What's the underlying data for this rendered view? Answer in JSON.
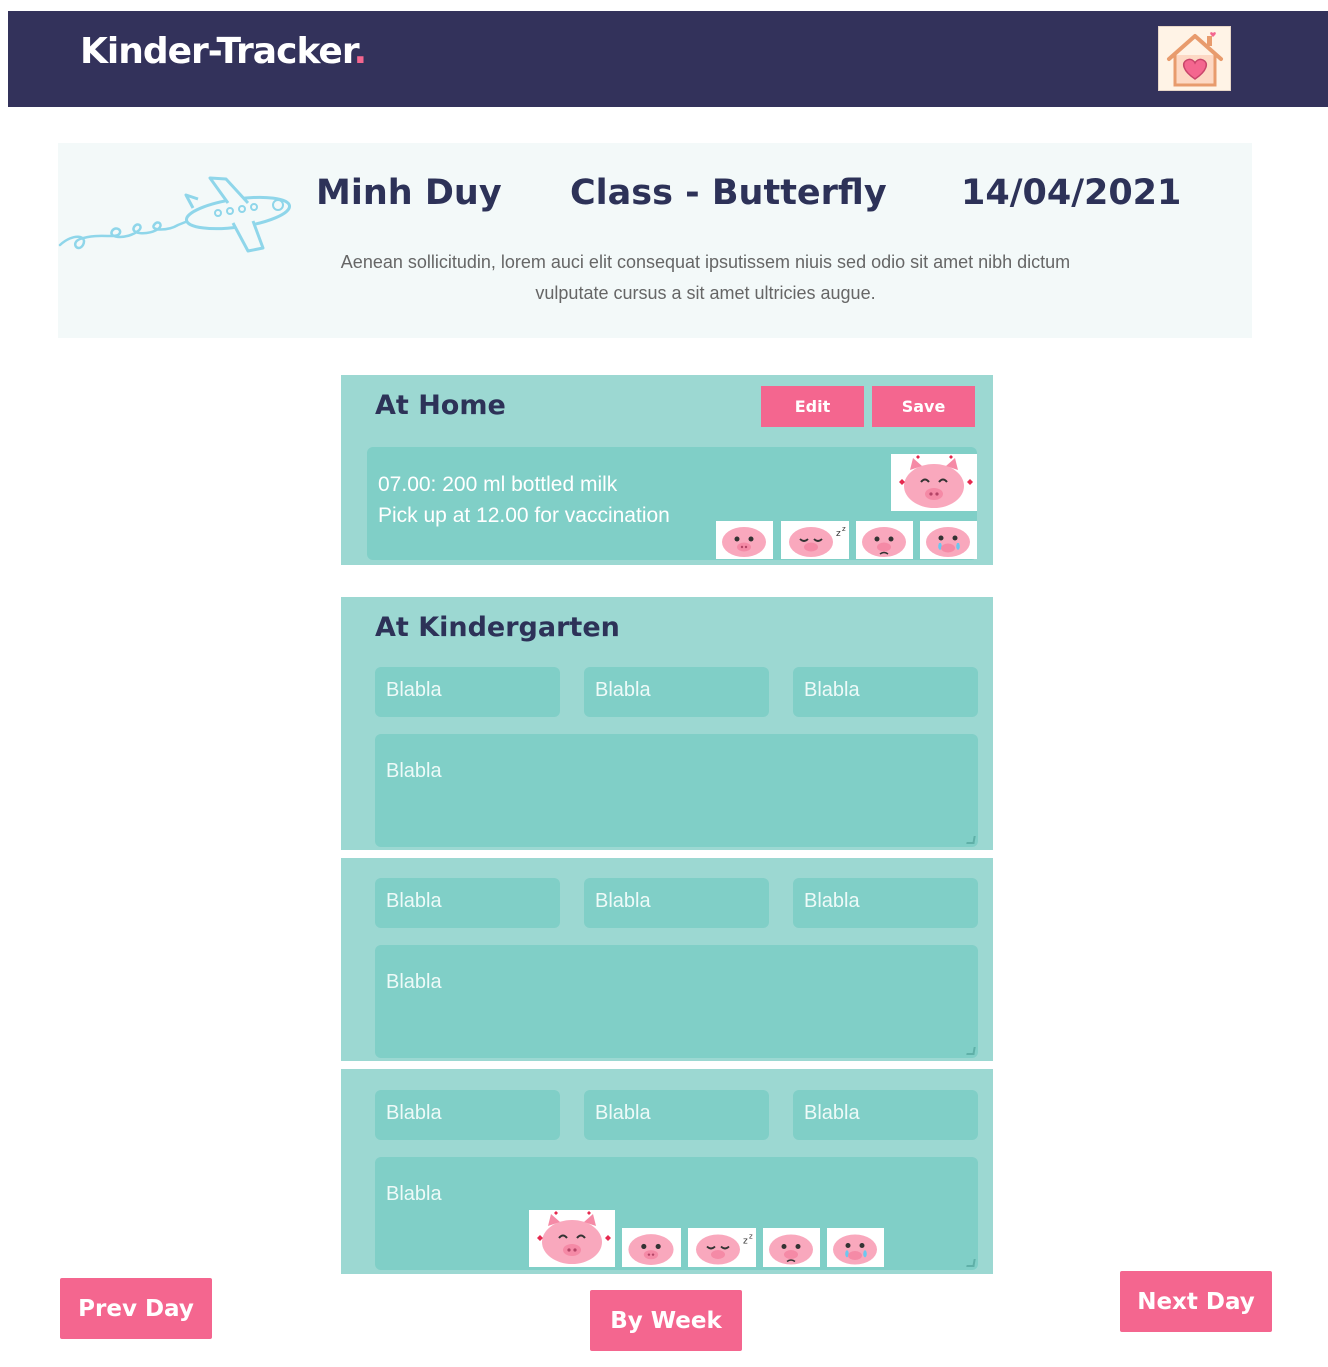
{
  "app": {
    "logo_text": "Kinder-Tracker",
    "logo_dot": ".",
    "home_icon": "house-heart-icon"
  },
  "profile": {
    "child_name": "Minh Duy",
    "class_label": "Class - Butterfly",
    "date": "14/04/2021",
    "description": "Aenean sollicitudin, lorem auci elit consequat ipsutissem niuis sed odio sit amet nibh dictum vulputate cursus a sit amet ultricies augue.",
    "decoration_icon": "airplane-icon"
  },
  "at_home": {
    "title": "At Home",
    "edit_label": "Edit",
    "save_label": "Save",
    "lines": [
      "07.00:  200 ml bottled milk",
      "Pick up at 12.00 for vaccination"
    ],
    "selected_mood": "pig-happy-love-icon",
    "mood_options": [
      "pig-happy-icon",
      "pig-sleepy-icon",
      "pig-sad-icon",
      "pig-crying-icon"
    ]
  },
  "at_kindergarten": {
    "title": "At Kindergarten",
    "blocks": [
      {
        "fields": [
          "Blabla",
          "Blabla",
          "Blabla"
        ],
        "notes": "Blabla"
      },
      {
        "fields": [
          "Blabla",
          "Blabla",
          "Blabla"
        ],
        "notes": "Blabla"
      },
      {
        "fields": [
          "Blabla",
          "Blabla",
          "Blabla"
        ],
        "notes": "Blabla"
      }
    ],
    "selected_mood": "pig-happy-love-icon",
    "mood_options": [
      "pig-happy-icon",
      "pig-sleepy-icon",
      "pig-sad-icon",
      "pig-crying-icon"
    ]
  },
  "navigation": {
    "prev_label": "Prev Day",
    "week_label": "By Week",
    "next_label": "Next Day"
  },
  "colors": {
    "header": "#33325b",
    "accent": "#f4668f",
    "section": "#9cd8d2",
    "field": "#80cfc7"
  }
}
